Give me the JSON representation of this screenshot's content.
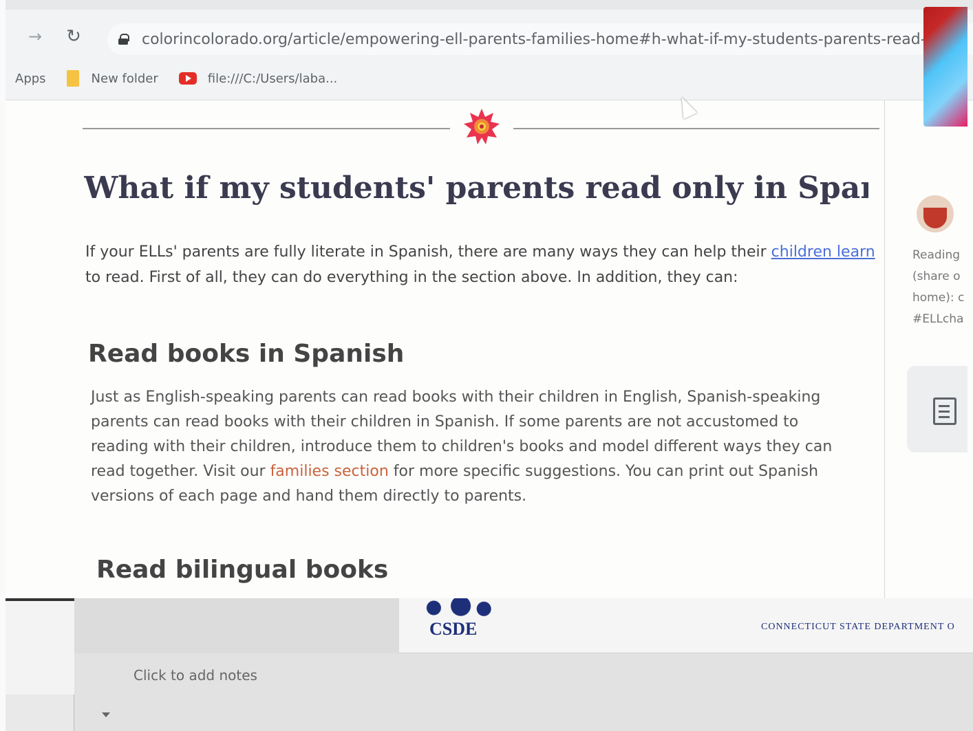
{
  "browser": {
    "url": "colorincolorado.org/article/empowering-ell-parents-families-home#h-what-if-my-students-parents-read-only",
    "bookmarks": [
      "Apps",
      "New folder",
      "file:///C:/Users/laba..."
    ]
  },
  "article": {
    "heading": "What if my students' parents read only in Spanish?",
    "intro": {
      "before_link": "If your ELLs' parents are fully literate in Spanish, there are many ways they can help their ",
      "link": "children learn",
      "after_link": " to read. First of all, they can do everything in the section above. In addition, they can:"
    },
    "section1": {
      "heading": "Read books in Spanish",
      "before_link": "Just as English-speaking parents can read books with their children in English, Spanish-speaking parents can read books with their children in Spanish. If some parents are not accustomed to reading with their children, introduce them to children's books and model different ways they can read together. Visit our ",
      "link": "families section",
      "after_link": " for more specific suggestions. You can print out Spanish versions of each page and hand them directly to parents."
    },
    "section2": {
      "heading": "Read bilingual books"
    }
  },
  "sidebar": {
    "text_lines": [
      "Reading",
      "(share o",
      "home): c",
      "#ELLcha"
    ]
  },
  "powerpoint": {
    "slide_logo": "CSDE",
    "slide_dept": "CONNECTICUT STATE DEPARTMENT O",
    "notes_placeholder": "Click to add notes"
  },
  "colors": {
    "link_blue": "#4a6fd6",
    "link_orange": "#c9623a",
    "heading": "#3a3a50"
  }
}
